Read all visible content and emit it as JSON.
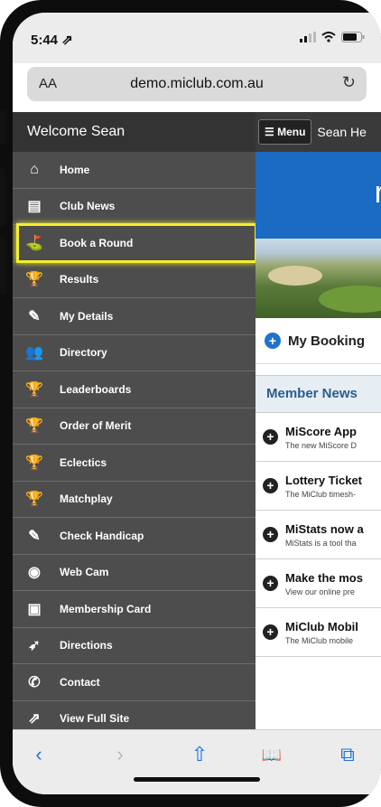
{
  "status_bar": {
    "time": "5:44 ⇗"
  },
  "browser": {
    "aa_label": "AA",
    "url": "demo.miclub.com.au",
    "reload_icon": "reload-icon"
  },
  "sidebar": {
    "welcome": "Welcome Sean",
    "items": [
      {
        "label": "Home",
        "icon": "home-icon",
        "glyph": "⌂"
      },
      {
        "label": "Club News",
        "icon": "news-icon",
        "glyph": "▤"
      },
      {
        "label": "Book a Round",
        "icon": "golf-ball-icon",
        "glyph": "⛳",
        "highlighted": true
      },
      {
        "label": "Results",
        "icon": "trophy-icon",
        "glyph": "🏆"
      },
      {
        "label": "My Details",
        "icon": "pencil-icon",
        "glyph": "✎"
      },
      {
        "label": "Directory",
        "icon": "people-icon",
        "glyph": "👥"
      },
      {
        "label": "Leaderboards",
        "icon": "trophy-list-icon",
        "glyph": "🏆"
      },
      {
        "label": "Order of Merit",
        "icon": "trophy-list-icon",
        "glyph": "🏆"
      },
      {
        "label": "Eclectics",
        "icon": "trophy-list-icon",
        "glyph": "🏆"
      },
      {
        "label": "Matchplay",
        "icon": "trophy-list-icon",
        "glyph": "🏆"
      },
      {
        "label": "Check Handicap",
        "icon": "pencil-icon",
        "glyph": "✎"
      },
      {
        "label": "Web Cam",
        "icon": "webcam-icon",
        "glyph": "◉"
      },
      {
        "label": "Membership Card",
        "icon": "id-card-icon",
        "glyph": "▣"
      },
      {
        "label": "Directions",
        "icon": "compass-icon",
        "glyph": "➶"
      },
      {
        "label": "Contact",
        "icon": "phone-icon",
        "glyph": "✆"
      },
      {
        "label": "View Full Site",
        "icon": "external-link-icon",
        "glyph": "⇗"
      }
    ]
  },
  "main": {
    "menu_button": "☰ Menu",
    "user_name": "Sean He",
    "banner_letter": "r",
    "my_bookings": "My Booking",
    "member_news_header": "Member News",
    "news": [
      {
        "title": "MiScore App",
        "desc": "The new MiScore D"
      },
      {
        "title": "Lottery Ticket",
        "desc": "The MiClub timesh-"
      },
      {
        "title": "MiStats now a",
        "desc": "MiStats is a tool tha"
      },
      {
        "title": "Make the mos",
        "desc": "View our online pre"
      },
      {
        "title": "MiClub Mobil",
        "desc": "The MiClub mobile"
      }
    ]
  },
  "toolbar": {
    "back_glyph": "‹",
    "forward_glyph": "›",
    "share_glyph": "⇧",
    "bookmarks_glyph": "📖",
    "tabs_glyph": "⧉"
  },
  "colors": {
    "sidebar_bg": "#4d4d4d",
    "highlight": "#f4ef2a",
    "banner_blue": "#1a6bc1",
    "accent_blue": "#1c74d9"
  }
}
